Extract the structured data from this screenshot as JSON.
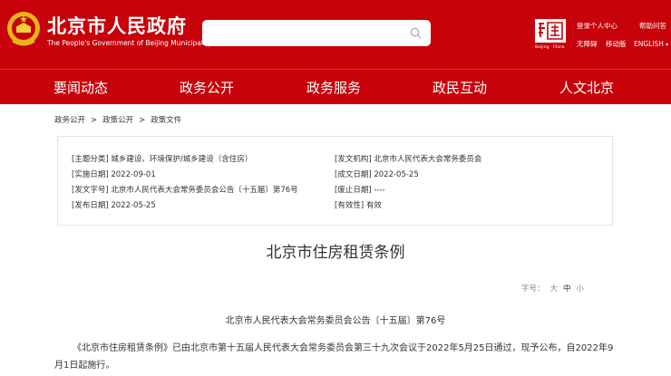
{
  "header": {
    "site_title": "北京市人民政府",
    "site_subtitle": "The People's Government of Beijing Municipality",
    "search": {
      "placeholder": ""
    },
    "capital_logo_sub": "Beijing · China",
    "links": {
      "login": "登录个人中心",
      "help": "帮助问答",
      "accessibility": "无障碍",
      "mobile": "移动版",
      "language": "ENGLISH"
    },
    "brand_color": "#c7020a"
  },
  "nav": [
    "要闻动态",
    "政务公开",
    "政务服务",
    "政民互动",
    "人文北京"
  ],
  "breadcrumb": [
    "政务公开",
    "政策公开",
    "政策文件"
  ],
  "info": {
    "category_label": "[主题分类]",
    "category": "城乡建设、环境保护/城乡建设（含住房）",
    "issuer_label": "[发文机构]",
    "issuer": "北京市人民代表大会常务委员会",
    "effective_label": "[实施日期]",
    "effective": "2022-09-01",
    "created_label": "[成文日期]",
    "created": "2022-05-25",
    "docno_label": "[发文字号]",
    "docno": "北京市人民代表大会常务委员会公告〔十五届〕第76号",
    "abolish_label": "[废止日期]",
    "abolish": "----",
    "published_label": "[发布日期]",
    "published": "2022-05-25",
    "validity_label": "[有效性]",
    "validity": "有效"
  },
  "article": {
    "title": "北京市住房租赁条例",
    "font_size": {
      "label": "字号：",
      "large": "大",
      "medium": "中",
      "small": "小",
      "selected": "中"
    },
    "subheading": "北京市人民代表大会常务委员会公告〔十五届〕第76号",
    "paragraph": "《北京市住房租赁条例》已由北京市第十五届人民代表大会常务委员会第三十九次会议于2022年5月25日通过，现予公布，自2022年9月1日起施行。"
  }
}
